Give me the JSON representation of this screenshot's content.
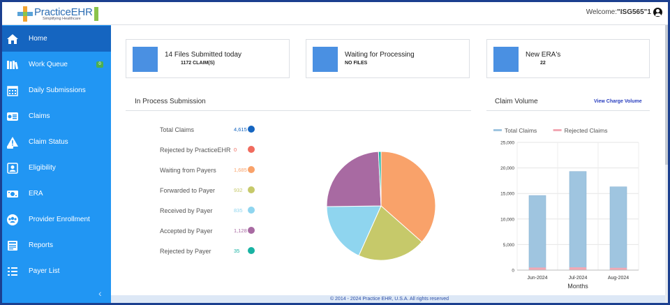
{
  "header": {
    "logo_name": "PracticeEHR",
    "logo_tag": "Simplifying Healthcare",
    "welcome_label": "Welcome:",
    "username": "\"ISG565\"1"
  },
  "sidebar": {
    "items": [
      {
        "label": "Home",
        "icon": "home-icon",
        "active": true
      },
      {
        "label": "Work Queue",
        "icon": "books-icon",
        "badge": "0"
      },
      {
        "label": "Daily Submissions",
        "icon": "calendar-icon"
      },
      {
        "label": "Claims",
        "icon": "claims-list-icon"
      },
      {
        "label": "Claim Status",
        "icon": "warning-dollar-icon"
      },
      {
        "label": "Eligibility",
        "icon": "id-card-icon"
      },
      {
        "label": "ERA",
        "icon": "money-icon"
      },
      {
        "label": "Provider Enrollment",
        "icon": "users-icon"
      },
      {
        "label": "Reports",
        "icon": "report-icon"
      },
      {
        "label": "Payer List",
        "icon": "list-icon"
      }
    ],
    "collapse_glyph": "‹"
  },
  "cards": [
    {
      "title": "14 Files Submitted today",
      "sub": "1172 CLAIM(S)"
    },
    {
      "title": "Waiting for Processing",
      "sub": "NO FILES"
    },
    {
      "title": "New ERA's",
      "sub": "22"
    }
  ],
  "in_process": {
    "title": "In Process Submission",
    "stats": [
      {
        "label": "Total Claims",
        "value": "4,615",
        "color": "#1565c0",
        "slice": null
      },
      {
        "label": "Rejected by PracticeEHR",
        "value": "0",
        "color": "#f06b5e",
        "slice": 0
      },
      {
        "label": "Waiting from Payers",
        "value": "1,685",
        "color": "#f9a26a",
        "slice": 1685
      },
      {
        "label": "Forwarded to Payer",
        "value": "932",
        "color": "#c6c96a",
        "slice": 932
      },
      {
        "label": "Received by Payer",
        "value": "835",
        "color": "#8fd5ef",
        "slice": 835
      },
      {
        "label": "Accepted by Payer",
        "value": "1,128",
        "color": "#a86aa2",
        "slice": 1128
      },
      {
        "label": "Rejected by Payer",
        "value": "35",
        "color": "#19b3a3",
        "slice": 35
      }
    ]
  },
  "claim_volume": {
    "title": "Claim Volume",
    "view_link": "View Charge Volume"
  },
  "chart_data": {
    "type": "bar",
    "categories": [
      "Jun-2024",
      "Jul-2024",
      "Aug-2024"
    ],
    "series": [
      {
        "name": "Total Claims",
        "values": [
          14600,
          19300,
          16300
        ],
        "color": "#9fc5e0"
      },
      {
        "name": "Rejected Claims",
        "values": [
          500,
          550,
          450
        ],
        "color": "#f2a8b4"
      }
    ],
    "xlabel": "Months",
    "ylabel": "",
    "ylim": [
      0,
      25000
    ],
    "yticks": [
      "0",
      "5,000",
      "10,000",
      "15,000",
      "20,000",
      "25,000"
    ],
    "legend": "top"
  },
  "footer": {
    "text": "© 2014 - 2024 Practice EHR, U.S.A. All rights reserved"
  }
}
